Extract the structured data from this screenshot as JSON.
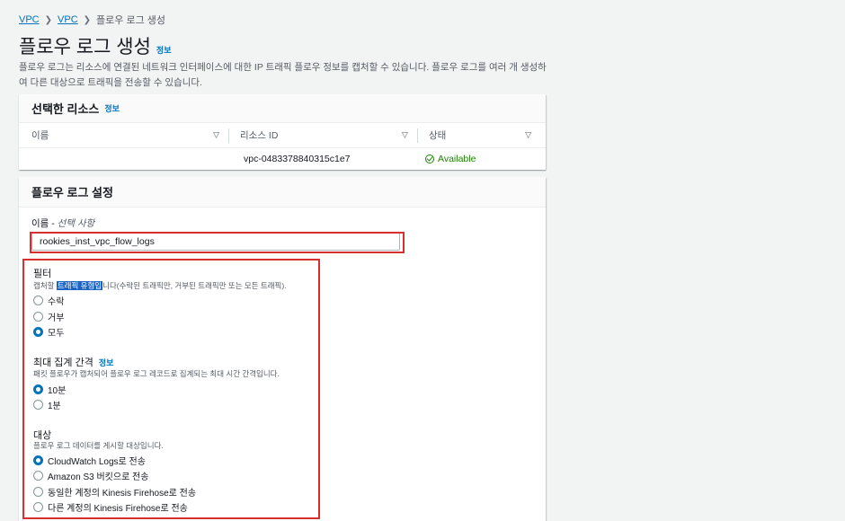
{
  "breadcrumb": {
    "item1": "VPC",
    "item2": "VPC",
    "current": "플로우 로그 생성"
  },
  "page": {
    "title": "플로우 로그 생성",
    "info": "정보",
    "description": "플로우 로그는 리소스에 연결된 네트워크 인터페이스에 대한 IP 트래픽 플로우 정보를 캡처할 수 있습니다. 플로우 로그를 여러 개 생성하여 다른 대상으로 트래픽을 전송할 수 있습니다."
  },
  "resources": {
    "title": "선택한 리소스",
    "info": "정보",
    "columns": [
      "이름",
      "리소스 ID",
      "상태"
    ],
    "row": {
      "name": "",
      "resource_id": "vpc-0483378840315c1e7",
      "status": "Available"
    }
  },
  "settings": {
    "title": "플로우 로그 설정",
    "name_label": "이름 - ",
    "name_optional": "선택 사항",
    "name_value": "rookies_inst_vpc_flow_logs",
    "filter": {
      "label": "필터",
      "desc_prefix": "캡처할 ",
      "desc_highlight": "트래픽 유형입",
      "desc_suffix": "니다(수락된 트래픽만, 거부된 트래픽만 또는 모든 트래픽).",
      "options": [
        "수락",
        "거부",
        "모두"
      ],
      "selected": "모두"
    },
    "interval": {
      "label": "최대 집계 간격",
      "info": "정보",
      "desc": "패킷 플로우가 캡처되어 플로우 로그 레코드로 집계되는 최대 시간 간격입니다.",
      "options": [
        "10분",
        "1분"
      ],
      "selected": "10분"
    },
    "destination": {
      "label": "대상",
      "desc": "플로우 로그 데이터를 게시할 대상입니다.",
      "options": [
        "CloudWatch Logs로 전송",
        "Amazon S3 버킷으로 전송",
        "동일한 계정의 Kinesis Firehose로 전송",
        "다른 계정의 Kinesis Firehose로 전송"
      ],
      "selected": "CloudWatch Logs로 전송"
    }
  },
  "colors": {
    "link": "#0073bb",
    "success": "#1d8102",
    "annotation": "#d9302f",
    "highlight": "#1a64c8"
  }
}
